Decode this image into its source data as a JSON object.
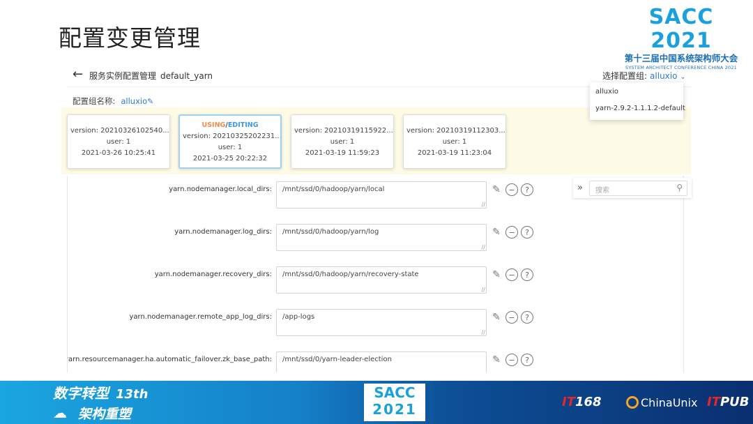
{
  "slide": {
    "title": "配置变更管理"
  },
  "logo": {
    "big": "SACC 2021",
    "cn": "第十三届中国系统架构师大会",
    "en": "SYSTEM ARCHITECT CONFERENCE CHINA 2021"
  },
  "header": {
    "back_icon": "arrow-left-icon",
    "breadcrumb": "服务实例配置管理",
    "instance": "default_yarn",
    "group_select_label": "选择配置组:",
    "group_select_value": "alluxio"
  },
  "group_name": {
    "label": "配置组名称:",
    "value": "alluxio"
  },
  "dropdown": {
    "options": [
      "alluxio",
      "yarn-2.9.2-1.1.1.2-default"
    ]
  },
  "versions": [
    {
      "version": "version: 20210326102540...",
      "user": "user: 1",
      "time": "2021-03-26 10:25:41"
    },
    {
      "status_using": "USING",
      "status_sep": "/",
      "status_editing": "EDITING",
      "version": "version: 20210325202231...",
      "user": "user: 1",
      "time": "2021-03-25 20:22:32"
    },
    {
      "version": "version: 20210319115922...",
      "user": "user: 1",
      "time": "2021-03-19 11:59:23"
    },
    {
      "version": "version: 20210319112303...",
      "user": "user: 1",
      "time": "2021-03-19 11:23:04"
    }
  ],
  "properties": [
    {
      "key": "yarn.nodemanager.local_dirs:",
      "value": "/mnt/ssd/0/hadoop/yarn/local"
    },
    {
      "key": "yarn.nodemanager.log_dirs:",
      "value": "/mnt/ssd/0/hadoop/yarn/log"
    },
    {
      "key": "yarn.nodemanager.recovery_dirs:",
      "value": "/mnt/ssd/0/hadoop/yarn/recovery-state"
    },
    {
      "key": "yarn.nodemanager.remote_app_log_dirs:",
      "value": "/app-logs"
    },
    {
      "key": "yarn.resourcemanager.ha.automatic_failover.zk_base_path:",
      "value": "/mnt/ssd/0/yarn-leader-election"
    }
  ],
  "search": {
    "placeholder": "搜索",
    "expand": "»"
  },
  "footer": {
    "slogan1": "数字转型",
    "slogan_num": "13th",
    "slogan2": "架构重塑",
    "badge1": "SACC",
    "badge2": "2021",
    "sponsor1_a": "IT",
    "sponsor1_b": "168",
    "sponsor2": "ChinaUnix",
    "sponsor3_a": "IT",
    "sponsor3_b": "PUB"
  }
}
